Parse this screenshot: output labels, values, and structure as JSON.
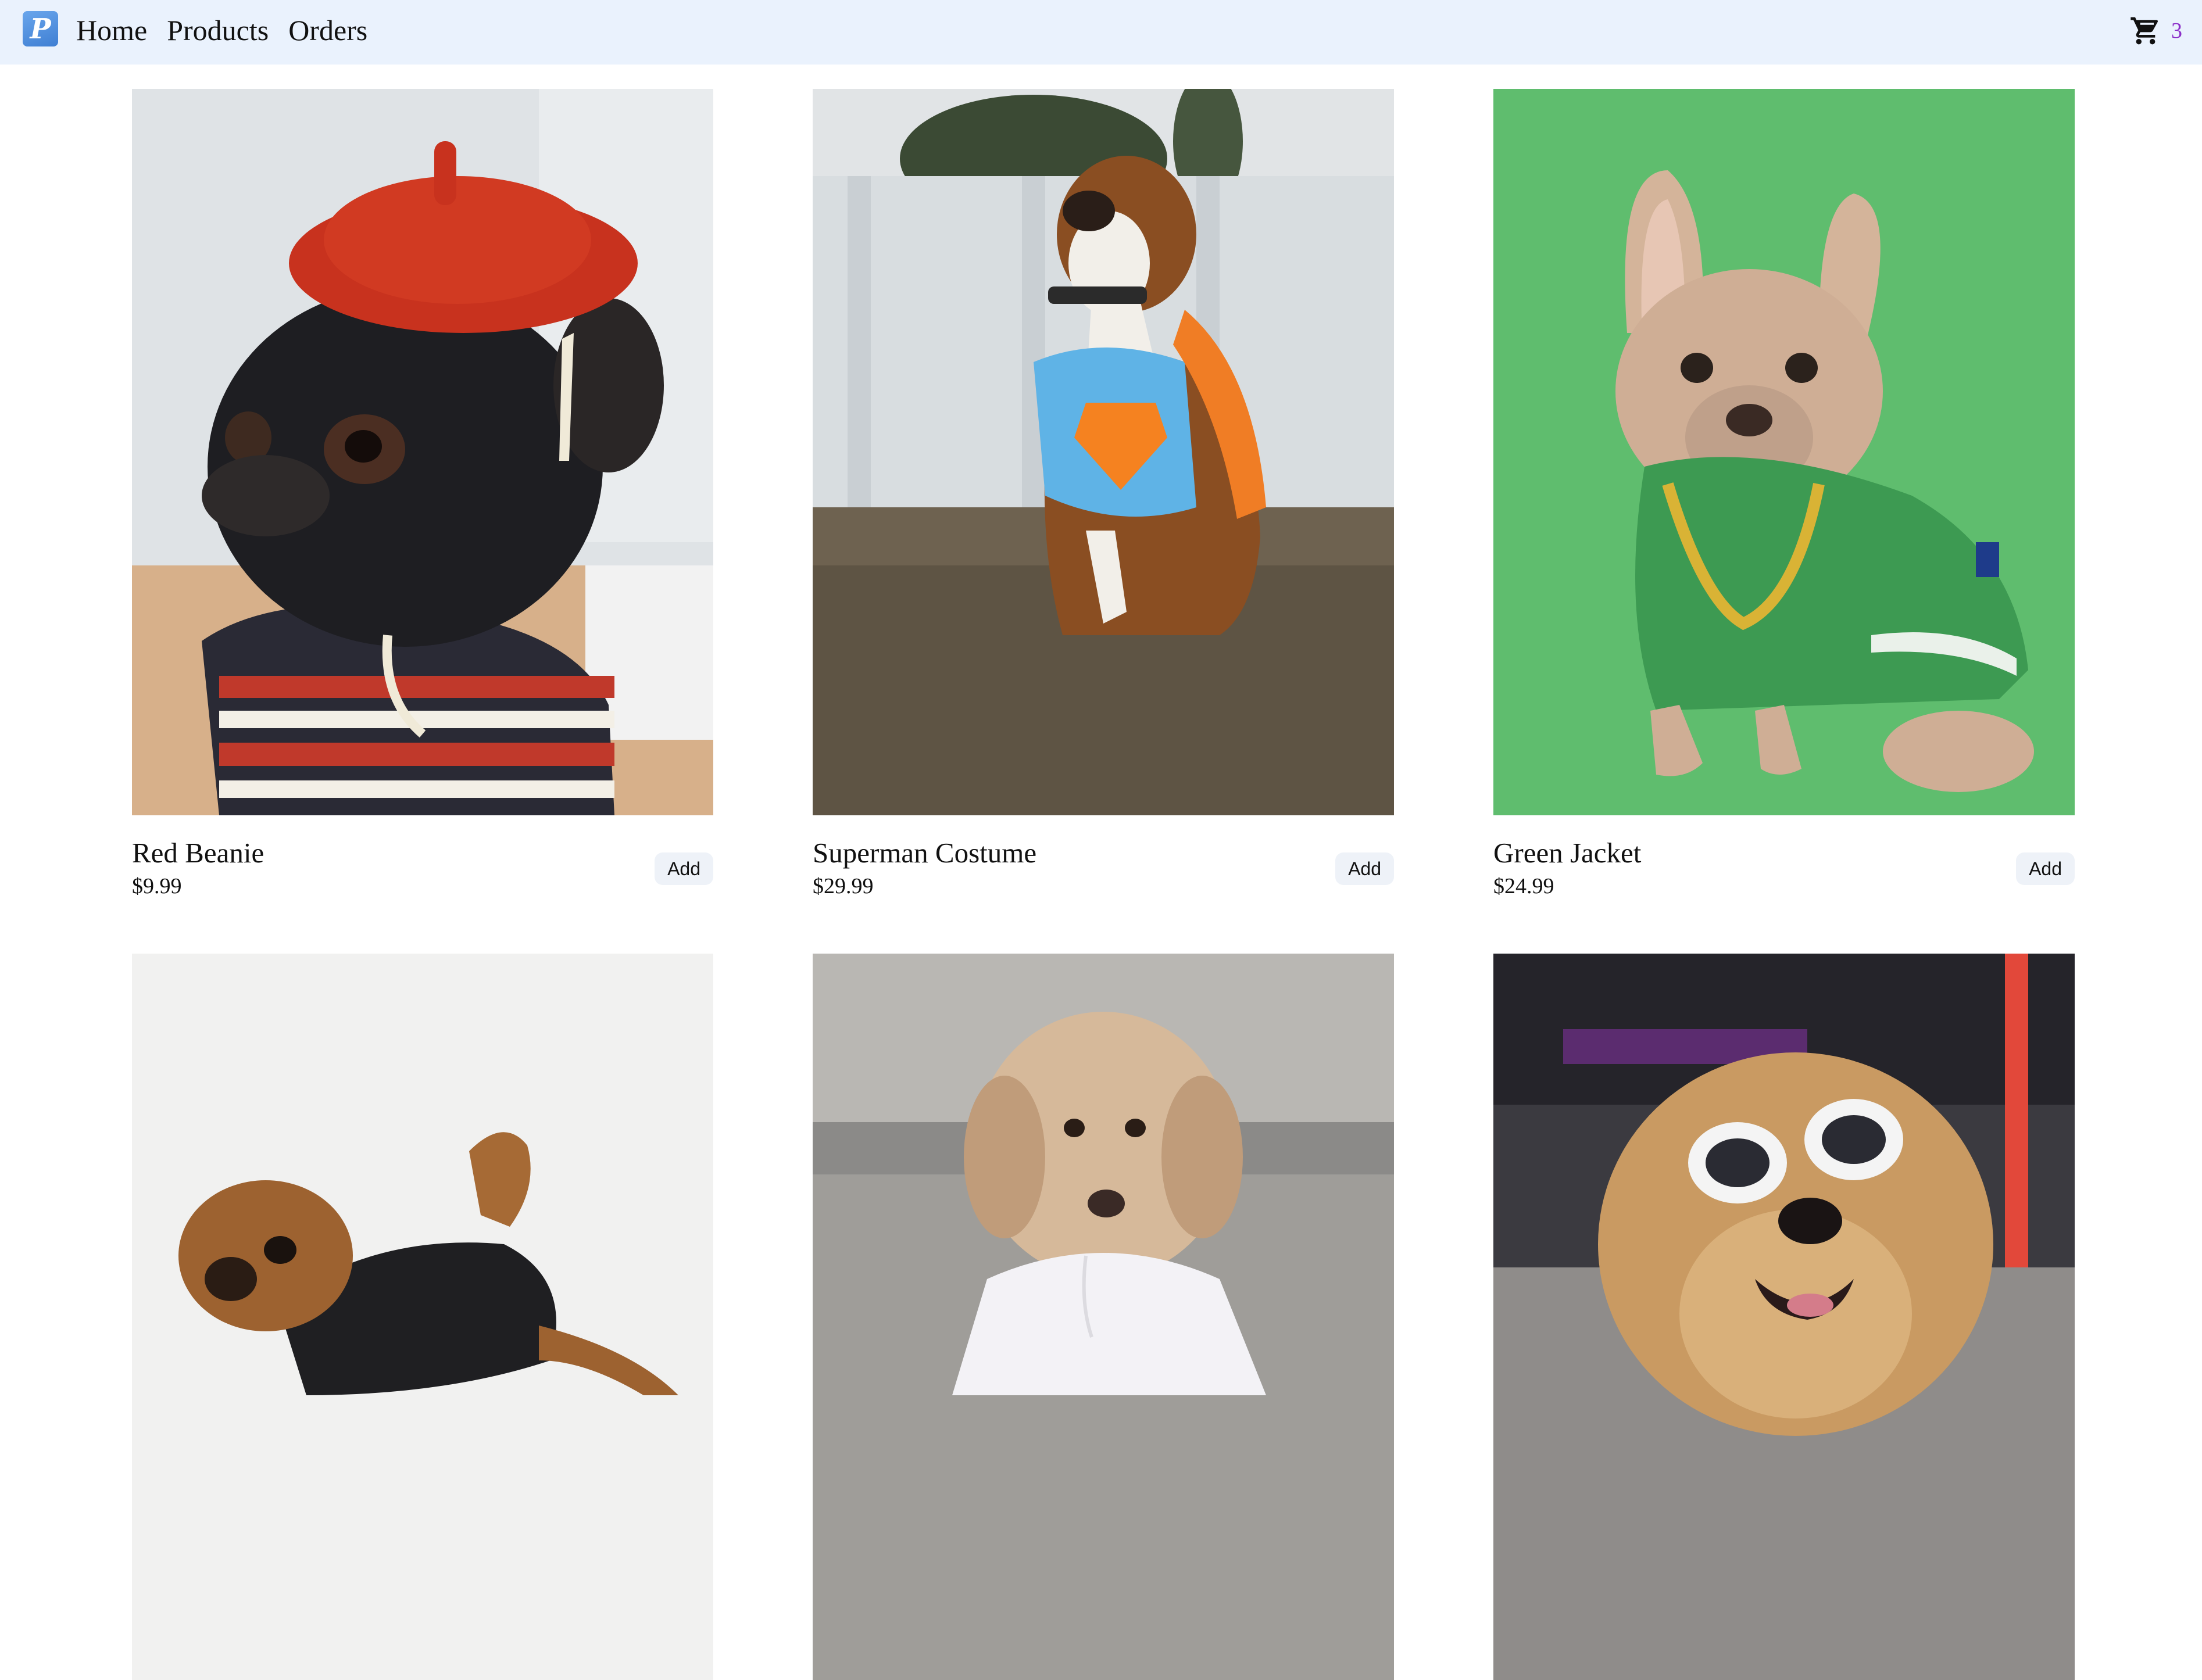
{
  "navbar": {
    "logo_letter": "P",
    "links": [
      "Home",
      "Products",
      "Orders"
    ],
    "cart_icon": "shopping-cart-icon",
    "cart_count": "3"
  },
  "products": [
    {
      "name": "Red Beanie",
      "price": "$9.99",
      "add_label": "Add"
    },
    {
      "name": "Superman Costume",
      "price": "$29.99",
      "add_label": "Add"
    },
    {
      "name": "Green Jacket",
      "price": "$24.99",
      "add_label": "Add"
    },
    {
      "name": "",
      "price": "",
      "add_label": ""
    },
    {
      "name": "",
      "price": "",
      "add_label": ""
    },
    {
      "name": "",
      "price": "",
      "add_label": ""
    }
  ],
  "colors": {
    "navbar_bg": "#eaf2fd",
    "logo_blue": "#4a8ade",
    "cart_count": "#8b2fc9",
    "button_bg": "#eef2f8"
  }
}
